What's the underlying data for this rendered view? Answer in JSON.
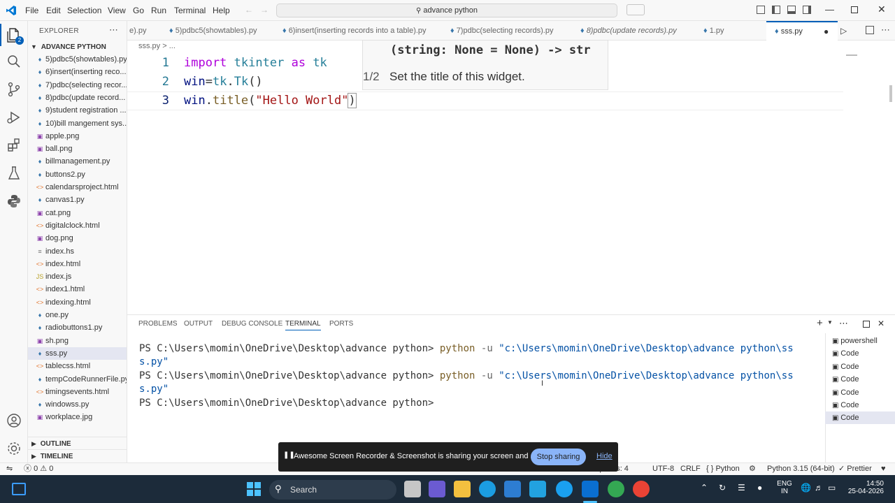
{
  "titlebar": {
    "menus": [
      "File",
      "Edit",
      "Selection",
      "View",
      "Go",
      "Run",
      "Terminal",
      "Help"
    ],
    "search": "advance python"
  },
  "sidebar": {
    "header": "EXPLORER",
    "folder": "ADVANCE PYTHON",
    "files": [
      {
        "name": "5)pdbc5(showtables).py",
        "icon": "python-icon"
      },
      {
        "name": "6)insert(inserting reco...",
        "icon": "python-icon"
      },
      {
        "name": "7)pdbc(selecting recor...",
        "icon": "python-icon"
      },
      {
        "name": "8)pdbc(update record...",
        "icon": "python-icon"
      },
      {
        "name": "9)student registration ...",
        "icon": "python-icon"
      },
      {
        "name": "10)bill mangement sys...",
        "icon": "python-icon"
      },
      {
        "name": "apple.png",
        "icon": "image-icon"
      },
      {
        "name": "ball.png",
        "icon": "image-icon"
      },
      {
        "name": "billmanagement.py",
        "icon": "python-icon"
      },
      {
        "name": "buttons2.py",
        "icon": "python-icon"
      },
      {
        "name": "calendarsproject.html",
        "icon": "html-icon"
      },
      {
        "name": "canvas1.py",
        "icon": "python-icon"
      },
      {
        "name": "cat.png",
        "icon": "image-icon"
      },
      {
        "name": "digitalclock.html",
        "icon": "html-icon"
      },
      {
        "name": "dog.png",
        "icon": "image-icon"
      },
      {
        "name": "index.hs",
        "icon": "file-icon"
      },
      {
        "name": "index.html",
        "icon": "html-icon"
      },
      {
        "name": "index.js",
        "icon": "js-icon"
      },
      {
        "name": "index1.html",
        "icon": "html-icon"
      },
      {
        "name": "indexing.html",
        "icon": "html-icon"
      },
      {
        "name": "one.py",
        "icon": "python-icon"
      },
      {
        "name": "radiobuttons1.py",
        "icon": "python-icon"
      },
      {
        "name": "sh.png",
        "icon": "image-icon"
      },
      {
        "name": "sss.py",
        "icon": "python-icon"
      },
      {
        "name": "tablecss.html",
        "icon": "html-icon"
      },
      {
        "name": "tempCodeRunnerFile.py",
        "icon": "python-icon"
      },
      {
        "name": "timingsevents.html",
        "icon": "html-icon"
      },
      {
        "name": "windowss.py",
        "icon": "python-icon"
      },
      {
        "name": "workplace.jpg",
        "icon": "image-icon"
      }
    ],
    "outline": "OUTLINE",
    "timeline": "TIMELINE"
  },
  "tabs": [
    "e).py",
    "5)pdbc5(showtables).py",
    "6)insert(inserting records into a table).py",
    "7)pdbc(selecting records).py",
    "8)pdbc(update records).py",
    "1.py",
    "sss.py"
  ],
  "editor": {
    "breadcrumb": "sss.py > ...",
    "line_numbers": [
      "1",
      "2",
      "3"
    ],
    "hover_signature": "(string: None = None) -> str",
    "hover_counter": "1/2",
    "hover_doc": "Set the title of this widget."
  },
  "panel": {
    "tabs": [
      "PROBLEMS",
      "OUTPUT",
      "DEBUG CONSOLE",
      "TERMINAL",
      "PORTS"
    ],
    "prompt": "PS C:\\Users\\momin\\OneDrive\\Desktop\\advance python>",
    "cmd": "python",
    "flag": "-u",
    "path1": "\"c:\\Users\\momin\\OneDrive\\Desktop\\advance python\\ss",
    "path2": "s.py\"",
    "terminals": [
      "powershell",
      "Code",
      "Code",
      "Code",
      "Code",
      "Code",
      "Code"
    ]
  },
  "statusbar": {
    "errors": "0",
    "warnings": "0",
    "spaces": "Spaces: 4",
    "encoding": "UTF-8",
    "eol": "CRLF",
    "language": "Python",
    "interpreter": "Python 3.15 (64-bit)",
    "prettier": "Prettier"
  },
  "notification": {
    "text": "Awesome Screen Recorder & Screenshot is sharing your screen and audio.",
    "stop": "Stop sharing",
    "hide": "Hide"
  },
  "taskbar": {
    "search": "Search",
    "lang1": "ENG",
    "lang2": "IN",
    "time": "14:50",
    "date": "25-04-2026"
  }
}
